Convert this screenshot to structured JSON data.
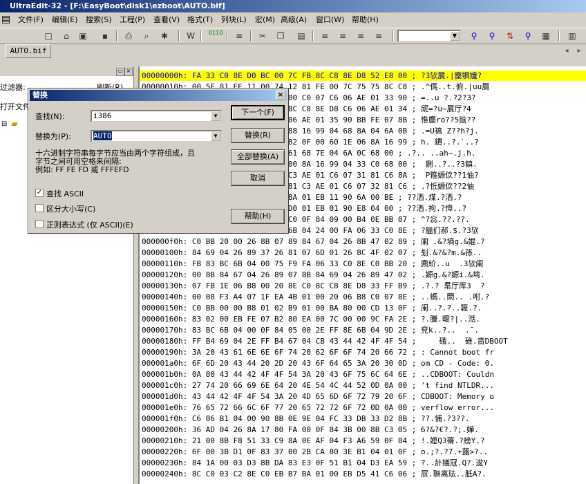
{
  "window": {
    "title": "UltraEdit-32 - [F:\\EasyBoot\\disk1\\ezboot\\AUTO.bif]"
  },
  "menu": [
    "文件(F)",
    "编辑(E)",
    "搜索(S)",
    "工程(P)",
    "查看(V)",
    "格式(T)",
    "列块(L)",
    "宏(M)",
    "高级(A)",
    "窗口(W)",
    "帮助(H)"
  ],
  "tab": {
    "label": "AUTO.bif"
  },
  "left_panel": {
    "filter_label": "过滤器:",
    "refresh_label": "刷新(R)",
    "open_files_label": "打开文件"
  },
  "dialog": {
    "title": "替换",
    "find_label": "查找(N):",
    "find_value": "i386",
    "replace_label": "替换为(P):",
    "replace_value": "AUTO",
    "hint": "十六进制字符串每字节应当由两个字符组成，且\n字节之间可用空格来间隔:\n例如: FF FE FD 或 FFFEFD",
    "find_next": "下一个(F)",
    "replace": "替换(R)",
    "replace_all": "全部替换(A)",
    "cancel": "取消",
    "help": "帮助(H)",
    "find_ascii": "查找 ASCII",
    "find_ascii_checked": true,
    "case_sensitive": "区分大小写(C)",
    "case_sensitive_checked": false,
    "regex": "正则表达式 (仅 ASCII)(E)",
    "regex_checked": false
  },
  "hex_rows": [
    "00000000h: FA 33 C0 8E D0 BC 00 7C FB 8C C8 8E D8 52 E8 00 ; ?3欤屓.|麋犋孅?",
    "00000010h: 00 5E 81 EE 11 00 74 12 81 FE 00 7C 75 75 8C C8 ; .^傌..t.俯.|uu屓",
    "00000020h: 3D 00 00 75 7F EA 37 00 C0 07 C6 06 AE 01 33 90 ; =..u ?.?2?3?",
    "00000030h: 8B F3 8B F3 83 C6 7E 8C C8 8E D8 C6 06 AE 01 34 ; 屔=?u~屓厅?4",
    "00000040h: 00 E8 B5 08 33 C0 C6 06 AE 01 35 90 BB FE 07 8B ; 惟麕ro??5谽??",
    "00000050h: 1E 33 90 BB 8E 0A 5A 88 16 99 04 68 8A 04 6A 0B ; .=U禞 Z??h?j.",
    "00000060h: 68 00 E8 68 7D 04 0F 82 0F 00 60 1E 06 8A 16 99 ; h. 鏆..?.`..?",
    "00000070h: 8E 2E C6 00 F0 07 1F 61 68 7E 04 6A 0C 68 00 ; .?.. ..ah~.j.h.",
    "00000080h: 8E 0A 6A 01 FF 06 35 00 8A 16 99 04 33 C0 68 00 ;  鍘..?..?3鎮.",
    "00000090h: 50 8B 1E 50 1E 0E 81 C3 AE 01 C6 07 31 81 C6 8A ;  P箍嫄佽??1伷?",
    "000000a0h: 3F 50 3F 07 8A 1E DE 81 C3 AE 01 C6 07 32 81 C6 ; .?忯嫄佽??2伷",
    "000000b0h: 3F 3F 8F 07 8A 00 BE 8A 01 EB 11 90 6A 00 BE ; ??洒.煤.?洒.?",
    "000000c0h: 3F 3F 8F 07 8A 00 BE D0 01 EB 01 90 E8 04 00 ; ??洒.拘.?愺..?",
    "000000d0h: 5E AC 0A C0 74 09 A0 C0 0F 84 09 00 B4 0E BB 07 ; ^?惢.??.??.",
    "000000e0h: 00 CD 10 EB F2 C3 84 6B 04 24 00 FA 06 33 C0 8E ; ?膃们郝.$.?3欤",
    "000000f0h: C0 BB 20 00 26 8B 07 89 84 67 04 26 8B 47 02 89 ; 阑 .&?墒g.&婫.?",
    "00000100h: 84 69 04 26 89 37 26 81 07 6D 01 26 8C 4F 02 07 ; 刬.&?&?m.&孫..",
    "00000110h: FB 83 BC 6B 04 00 75 F9 FA 06 33 C0 8E C0 BB 20 ; 麃紒..u  .3欤阑",
    "00000120h: 00 8B 84 67 04 26 89 07 8B 84 69 04 26 89 47 02 ; .嫄g.&?嫄i.&塆.",
    "00000130h: 07 FB 1E 06 B8 00 20 8E C0 8C C8 8E D8 33 FF B9 ; .?.? 帬厅厍3  ?",
    "00000140h: 00 08 F3 A4 07 1F EA 4B 01 00 20 06 B8 C0 07 8E ; ..螞..閖.. .咐.?",
    "00000150h: C0 BB 00 00 B8 01 02 B9 01 00 BA 80 00 CD 13 0F ; 阑..?.?..簚.?.",
    "00000160h: 83 02 00 EB FE 07 B2 80 EA 00 7C 00 00 9C FA 2E ; ?.黱.曖?|..湉.",
    "00000170h: 83 BC 6B 04 00 0F 84 05 00 2E FF 8E 6B 04 9D 2E ; 兗k..?..  .ˉ.",
    "00000180h: FF B4 69 04 2E FF B4 67 04 CB 43 44 42 4F 4F 54 ;     硪..  碓.啬DBOOT",
    "00000190h: 3A 20 43 61 6E 6E 6F 74 20 62 6F 6F 74 20 66 72 ; : Cannot boot fr",
    "000001a0h: 6F 6D 20 43 44 20 2D 20 43 6F 64 65 3A 20 30 0D ; om CD - Code: 0.",
    "000001b0h: 0A 00 43 44 42 4F 4F 54 3A 20 43 6F 75 6C 64 6E ; ..CDBOOT: Couldn",
    "000001c0h: 27 74 20 66 69 6E 64 20 4E 54 4C 44 52 0D 0A 00 ; 't find NTLDR...",
    "000001d0h: 43 44 42 4F 4F 54 3A 20 4D 65 6D 6F 72 79 20 6F ; CDBOOT: Memory o",
    "000001e0h: 76 65 72 66 6C 6F 77 20 65 72 72 6F 72 0D 0A 00 ; verflow error...",
    "000001f0h: C6 06 B1 04 00 90 8B 0E 9E 04 FC 33 DB 33 D2 8B ; ??.悑.?3??.",
    "00000200h: 36 AD 04 26 8A 17 80 FA 00 0F 84 3B 00 8B C3 05 ; 6?&?€?.?;.嬅.",
    "00000210h: 21 00 8B F8 51 33 C9 8A 0E AF 04 F3 A6 59 0F 84 ; !.嬤Q3蓨.?螃Y.?",
    "00000220h: 6F 00 3B D1 0F 83 37 00 2B CA 80 3E B1 04 01 0F ; o.;?.?7.+蕗>?..",
    "00000230h: 84 1A 00 03 D3 8B DA 83 E3 0F 51 B1 04 D3 EA 59 ; ?..計嬟冦.Q?.逡Y",
    "00000240h: 8C C0 03 C2 8E C0 EB B7 BA 01 00 EB D5 41 C6 06 ; 屃.聨离珐..胝A?."
  ]
}
